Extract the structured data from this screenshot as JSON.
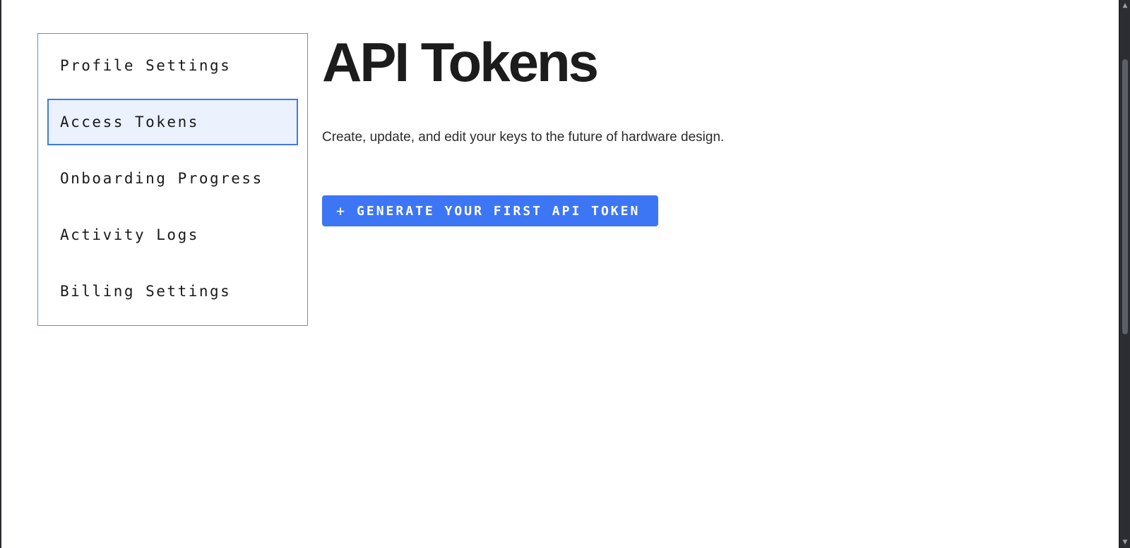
{
  "sidebar": {
    "items": [
      {
        "label": "Profile Settings",
        "active": false
      },
      {
        "label": "Access Tokens",
        "active": true
      },
      {
        "label": "Onboarding Progress",
        "active": false
      },
      {
        "label": "Activity Logs",
        "active": false
      },
      {
        "label": "Billing Settings",
        "active": false
      }
    ]
  },
  "main": {
    "title": "API Tokens",
    "description": "Create, update, and edit your keys to the future of hardware design.",
    "generate_button": {
      "icon": "+",
      "label": "GENERATE YOUR FIRST API TOKEN"
    }
  },
  "scrollbar": {
    "up_arrow": "▲",
    "down_arrow": "▼"
  },
  "colors": {
    "accent": "#3d76f5",
    "active_item_bg": "#ebf1fd",
    "sidebar_border": "#5a8dee"
  }
}
